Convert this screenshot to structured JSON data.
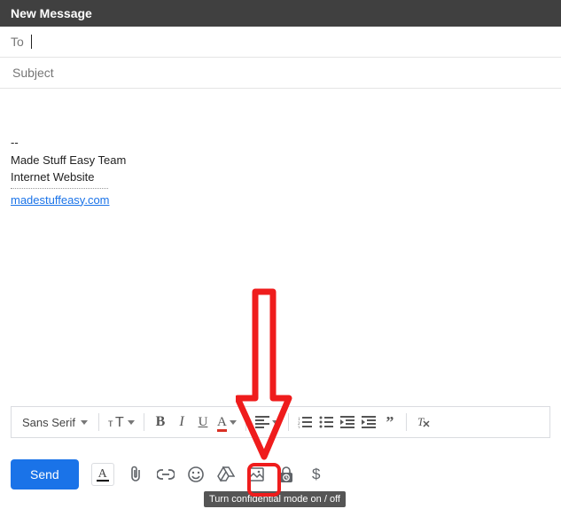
{
  "titlebar": {
    "text": "New Message"
  },
  "to_field": {
    "label": "To",
    "value": ""
  },
  "subject_field": {
    "placeholder": "Subject",
    "value": ""
  },
  "signature": {
    "dashes": "--",
    "line1": "Made Stuff Easy Team",
    "line2": "Internet Website",
    "link_text": "madestuffeasy.com"
  },
  "format_toolbar": {
    "font_family": "Sans Serif"
  },
  "send_row": {
    "send_label": "Send",
    "dollar": "$"
  },
  "tooltip": "Turn confidential mode on / off"
}
